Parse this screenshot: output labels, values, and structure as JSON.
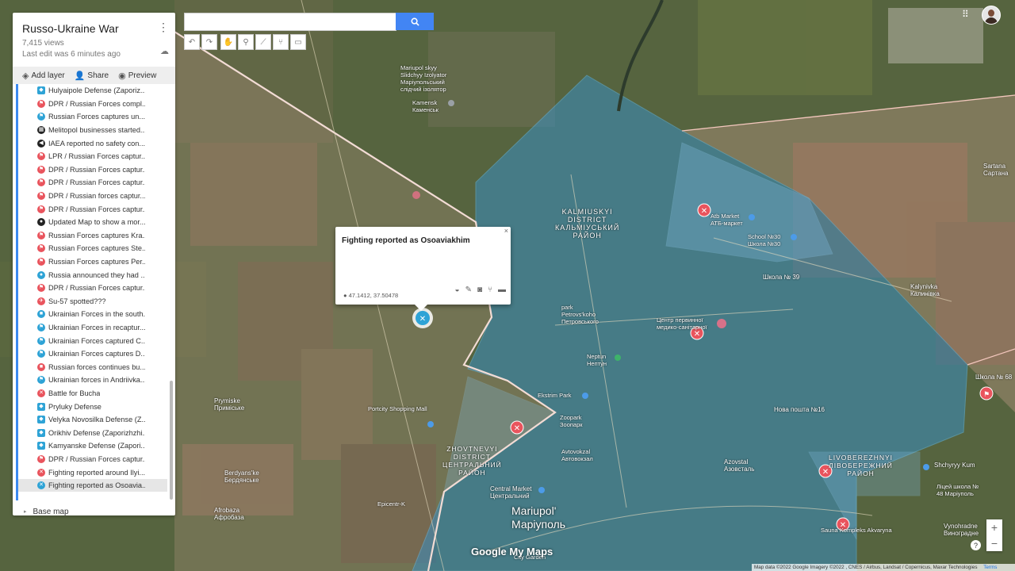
{
  "panel": {
    "title": "Russo-Ukraine War",
    "views": "7,415 views",
    "last_edit": "Last edit was 6 minutes ago",
    "toolbar": {
      "add_layer": "Add layer",
      "share": "Share",
      "preview": "Preview"
    },
    "items": [
      {
        "label": "Hulyaipole Defense (Zaporiz...",
        "marker": "blue",
        "icon": "defense-icon"
      },
      {
        "label": "DPR / Russian Forces compl...",
        "marker": "red",
        "icon": "flag-icon"
      },
      {
        "label": "Russian Forces captures un...",
        "marker": "blue",
        "icon": "flag-icon"
      },
      {
        "label": "Melitopol businesses started...",
        "marker": "black",
        "icon": "shop-icon"
      },
      {
        "label": "IAEA reported no safety con...",
        "marker": "black",
        "icon": "megaphone-icon"
      },
      {
        "label": "LPR / Russian Forces captur...",
        "marker": "red",
        "icon": "flag-icon"
      },
      {
        "label": "DPR / Russian Forces captur...",
        "marker": "red",
        "icon": "flag-icon"
      },
      {
        "label": "DPR / Russian Forces captur...",
        "marker": "red",
        "icon": "flag-icon"
      },
      {
        "label": "DPR / Russian forces captur...",
        "marker": "red",
        "icon": "flag-icon"
      },
      {
        "label": "DPR / Russian Forces captur...",
        "marker": "red",
        "icon": "flag-icon"
      },
      {
        "label": "Updated Map to show a mor...",
        "marker": "black",
        "icon": "pin-icon"
      },
      {
        "label": "Russian Forces captures Kra...",
        "marker": "red",
        "icon": "flag-icon"
      },
      {
        "label": "Russian Forces captures Ste...",
        "marker": "red",
        "icon": "flag-icon"
      },
      {
        "label": "Russian Forces captures Per...",
        "marker": "red",
        "icon": "flag-icon"
      },
      {
        "label": "Russia announced they had ...",
        "marker": "blue",
        "icon": "pin-icon"
      },
      {
        "label": "DPR / Russian Forces captur...",
        "marker": "red",
        "icon": "flag-icon"
      },
      {
        "label": "Su-57 spotted???",
        "marker": "red",
        "icon": "plane-icon"
      },
      {
        "label": "Ukrainian Forces in the south...",
        "marker": "blue",
        "icon": "tank-icon"
      },
      {
        "label": "Ukrainian Forces in recaptur...",
        "marker": "blue",
        "icon": "flag-icon"
      },
      {
        "label": "Ukrainian Forces captured C...",
        "marker": "blue",
        "icon": "flag-icon"
      },
      {
        "label": "Ukrainian Forces captures D...",
        "marker": "blue",
        "icon": "flag-icon"
      },
      {
        "label": "Russian forces continues bu...",
        "marker": "red",
        "icon": "tank-icon"
      },
      {
        "label": "Ukrainian forces in Andriivka...",
        "marker": "blue",
        "icon": "flag-icon"
      },
      {
        "label": "Battle for Bucha",
        "marker": "red",
        "icon": "battle-icon"
      },
      {
        "label": "Pryluky Defense",
        "marker": "blue",
        "icon": "defense-icon"
      },
      {
        "label": "Velyka Novosilka Defense (Z...",
        "marker": "blue",
        "icon": "defense-icon"
      },
      {
        "label": "Orikhiv Defense (Zaporizhzhi...",
        "marker": "blue",
        "icon": "defense-icon"
      },
      {
        "label": "Kamyanske Defense (Zapori...",
        "marker": "blue",
        "icon": "defense-icon"
      },
      {
        "label": "DPR / Russian Forces captur...",
        "marker": "red",
        "icon": "flag-icon"
      },
      {
        "label": "Fighting reported around Ilyi...",
        "marker": "red",
        "icon": "battle-icon"
      },
      {
        "label": "Fighting reported as Osoavia...",
        "marker": "blue",
        "icon": "battle-icon",
        "selected": true
      }
    ],
    "base_map": "Base map"
  },
  "popup": {
    "title": "Fighting reported as Osoaviakhim",
    "close": "×",
    "coords": "47.1412, 37.50478"
  },
  "map_labels": [
    {
      "text": "Mariupol skyy\nSlidchyy Izolyator\nМаріупольський\nслідчий ізолятор",
      "kind": "poi"
    },
    {
      "text": "Kamensk\nКаменськ",
      "kind": "poi"
    },
    {
      "text": "KALMIUSKYI\nDISTRICT\nКАЛЬМІУСЬКИЙ\nРАЙОН",
      "kind": "district"
    },
    {
      "text": "Atb Market\nАТБ-маркет",
      "kind": "poi"
    },
    {
      "text": "School №30\nШкола №30",
      "kind": "poi"
    },
    {
      "text": "Школа № 39",
      "kind": "poi"
    },
    {
      "text": "park\nPetrovs'koho\nПетровського",
      "kind": "poi"
    },
    {
      "text": "Центр первинної\nмедико-санітарної",
      "kind": "poi"
    },
    {
      "text": "Neptun\nНептун",
      "kind": "poi"
    },
    {
      "text": "Ekstrim Park",
      "kind": "poi"
    },
    {
      "text": "Zoopark\nЗоопарк",
      "kind": "poi"
    },
    {
      "text": "Avtovokzal\nАвтовокзал",
      "kind": "poi"
    },
    {
      "text": "Нова пошта №16",
      "kind": "poi"
    },
    {
      "text": "Azovstal\nАзовсталь",
      "kind": "poi"
    },
    {
      "text": "ZHOVTNEVYI\nDISTRICT\nЦЕНТРАЛЬНИЙ\nРАЙОН",
      "kind": "district"
    },
    {
      "text": "LIVOBEREZHNYI\nЛІВОБЕРЕЖНИЙ\nРАЙОН",
      "kind": "district"
    },
    {
      "text": "Central Market\nЦентральний",
      "kind": "poi"
    },
    {
      "text": "Mariupol'\nМаріуполь",
      "kind": "city"
    },
    {
      "text": "Kalynivka\nКалинівка",
      "kind": "town"
    },
    {
      "text": "Sartana\nСартана",
      "kind": "town"
    },
    {
      "text": "Школа № 68",
      "kind": "poi"
    },
    {
      "text": "Shchyryy Kum",
      "kind": "poi"
    },
    {
      "text": "Ліцей школа №\n48 Маріуполь",
      "kind": "poi"
    },
    {
      "text": "Saunа Kompleks Akvaryna",
      "kind": "poi"
    },
    {
      "text": "Vynohradne\nВиноградне",
      "kind": "town"
    },
    {
      "text": "Prymiske\nПримiське",
      "kind": "town"
    },
    {
      "text": "Portcity Shopping Mall",
      "kind": "poi"
    },
    {
      "text": "Berdyans'ke\nБердянське",
      "kind": "town"
    },
    {
      "text": "Afrobaza\nАфробаза",
      "kind": "town"
    },
    {
      "text": "Epicentr-K",
      "kind": "poi"
    },
    {
      "text": "City Garden",
      "kind": "poi"
    }
  ],
  "branding": "Google My Maps",
  "attribution": "Map data ©2022 Google Imagery ©2022 , CNES / Airbus, Landsat / Copernicus, Maxar Technologies",
  "terms": "Terms",
  "colors": {
    "ukraine_area": "#3a8fc0",
    "russia_area": "#e8b1a5",
    "marker_red": "#e9545d",
    "marker_blue": "#2ea3d6",
    "accent": "#4285f4"
  }
}
